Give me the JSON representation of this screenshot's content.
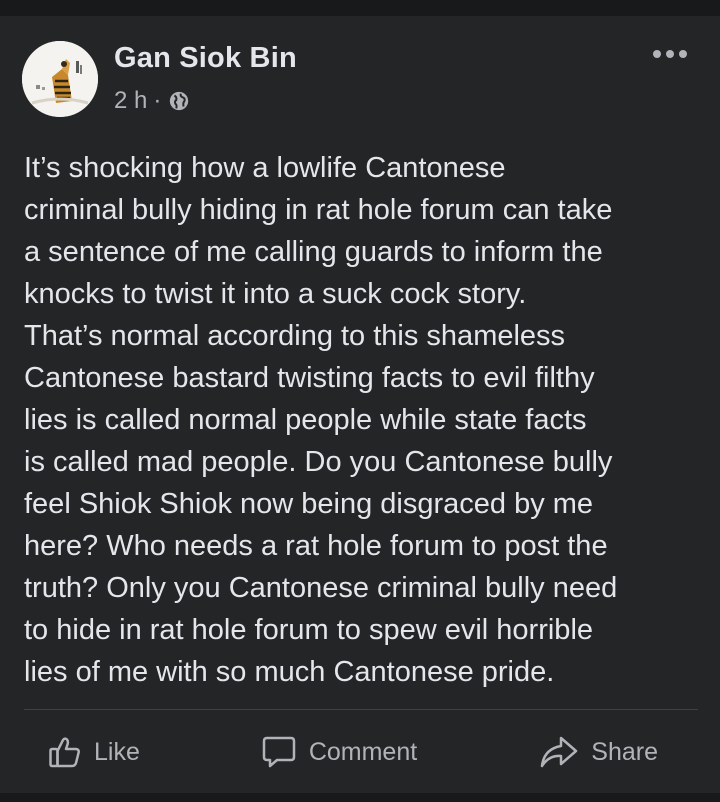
{
  "post": {
    "author": "Gan Siok Bin",
    "time": "2 h",
    "separator": "·",
    "audience_icon": "globe-icon",
    "menu_icon": "more-horizontal-icon",
    "body": "It’s shocking how a lowlife Cantonese\ncriminal bully hiding in rat hole forum can take\na sentence of me calling guards to inform the\nknocks to twist it into a suck cock story.\nThat’s normal according to this shameless\nCantonese bastard twisting facts to evil filthy\nlies is called normal people while state facts\nis called mad people. Do you Cantonese bully\nfeel Shiok Shiok now being disgraced by me\nhere? Who needs a rat hole forum to post the\ntruth? Only you Cantonese criminal bully need\nto hide in rat hole forum to spew evil horrible\nlies of me with so much Cantonese pride."
  },
  "actions": {
    "like_label": "Like",
    "like_icon": "thumbs-up-icon",
    "comment_label": "Comment",
    "comment_icon": "speech-bubble-icon",
    "share_label": "Share",
    "share_icon": "share-arrow-icon"
  },
  "colors": {
    "page_background": "#18191a",
    "card_background": "#242526",
    "primary_text": "#e4e6eb",
    "secondary_text": "#b0b3b8",
    "divider": "#3e4042"
  }
}
